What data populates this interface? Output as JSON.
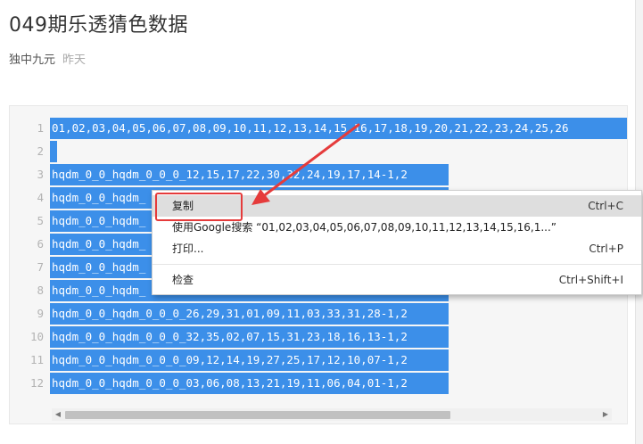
{
  "article": {
    "title": "049期乐透猜色数据",
    "author": "独中九元",
    "date": "昨天"
  },
  "code": {
    "line_numbers": [
      "1",
      "2",
      "3",
      "4",
      "5",
      "6",
      "7",
      "8",
      "9",
      "10",
      "11",
      "12"
    ],
    "lines": [
      "01,02,03,04,05,06,07,08,09,10,11,12,13,14,15,16,17,18,19,20,21,22,23,24,25,26",
      "",
      "hqdm_0_0_hqdm_0_0_0_12,15,17,22,30,32,24,19,17,14-1,2",
      "hqdm_0_0_hqdm_",
      "hqdm_0_0_hqdm_",
      "hqdm_0_0_hqdm_",
      "hqdm_0_0_hqdm_",
      "hqdm_0_0_hqdm_",
      "hqdm_0_0_hqdm_0_0_0_26,29,31,01,09,11,03,33,31,28-1,2",
      "hqdm_0_0_hqdm_0_0_0_32,35,02,07,15,31,23,18,16,13-1,2",
      "hqdm_0_0_hqdm_0_0_0_09,12,14,19,27,25,17,12,10,07-1,2",
      "hqdm_0_0_hqdm_0_0_0_03,06,08,13,21,19,11,06,04,01-1,2"
    ]
  },
  "context_menu": {
    "copy": {
      "label": "复制",
      "shortcut": "Ctrl+C"
    },
    "search": {
      "label": "使用Google搜索 “01,02,03,04,05,06,07,08,09,10,11,12,13,14,15,16,1...”"
    },
    "print": {
      "label": "打印...",
      "shortcut": "Ctrl+P"
    },
    "inspect": {
      "label": "检查",
      "shortcut": "Ctrl+Shift+I"
    }
  },
  "colors": {
    "selection": "#3c8fe9",
    "highlight_box": "#e53b3b",
    "annotation_arrow": "#e53b3b"
  },
  "icons": {
    "scroll_left": "triangle-left",
    "scroll_right": "triangle-right"
  }
}
